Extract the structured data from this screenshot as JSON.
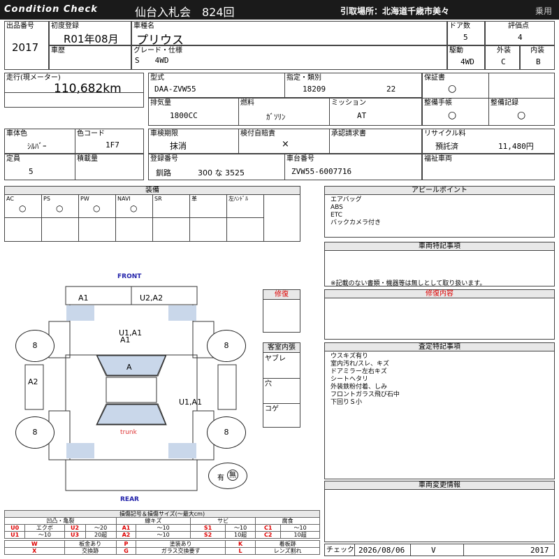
{
  "header": {
    "brand": "Condition Check",
    "auction": "仙台入札会　824回",
    "pickup": "引取場所：北海道千歳市美々",
    "category": "乗用"
  },
  "vehicle": {
    "lot_label": "出品番号",
    "lot": "2017",
    "first_reg_label": "初度登録",
    "first_reg": "R01年08月",
    "model_name_label": "車種名",
    "model_name": "プリウス",
    "doors_label": "ドア数",
    "doors": "5",
    "score_label": "評価点",
    "score": "4",
    "history_label": "車歴",
    "grade_label": "グレード・仕様",
    "grade": "S　　4WD",
    "drive_label": "駆動",
    "drive": "4WD",
    "exterior_label": "外装",
    "exterior": "C",
    "interior_label": "内装",
    "interior": "B",
    "mileage_label": "走行(現メーター)",
    "mileage": "110,682km",
    "type_label": "型式",
    "type": "DAA-ZVW55",
    "designation_label": "指定・類別",
    "designation": "18209",
    "class": "22",
    "warranty_label": "保証書",
    "warranty": "○",
    "displacement_label": "排気量",
    "displacement": "1800CC",
    "fuel_label": "燃料",
    "fuel": "ｶﾞｿﾘﾝ",
    "transmission_label": "ミッション",
    "transmission": "AT",
    "manual_label": "整備手帳",
    "manual": "○",
    "service_label": "整備記録",
    "service": "○",
    "color_label": "車体色",
    "color": "ｼﾙﾊﾞｰ",
    "color_code_label": "色コード",
    "color_code": "1F7",
    "inspection_label": "車検期限",
    "inspection": "抹消",
    "insurance_label": "検付自賠責",
    "insurance": "×",
    "approval_label": "承認請求書",
    "recycle_label": "リサイクル料",
    "recycle_status": "預託済",
    "recycle_fee": "11,480円",
    "capacity_label": "定員",
    "capacity": "5",
    "load_label": "積載量",
    "plate_label": "登録番号",
    "plate_area": "釧路",
    "plate_num": "300 な 3525",
    "chassis_label": "車台番号",
    "chassis": "ZVW55-6007716",
    "welfare_label": "福祉車両"
  },
  "equipment": {
    "title": "装備",
    "items": [
      {
        "label": "AC",
        "mark": "○"
      },
      {
        "label": "PS",
        "mark": "○"
      },
      {
        "label": "PW",
        "mark": "○"
      },
      {
        "label": "NAVI",
        "mark": "○"
      },
      {
        "label": "SR",
        "mark": ""
      },
      {
        "label": "革",
        "mark": ""
      },
      {
        "label": "左ﾊﾝﾄﾞﾙ",
        "mark": ""
      }
    ]
  },
  "appeal": {
    "title": "アピールポイント",
    "lines": [
      "エアバッグ",
      "ABS",
      "ETC",
      "バックカメラ付き"
    ]
  },
  "notes": {
    "title": "車両特記事項",
    "text": "※記載のない書類・機器等は無しとして取り扱います。"
  },
  "repair_content": {
    "title": "修復内容"
  },
  "inspection_notes": {
    "title": "査定特記事項",
    "lines": [
      "ウスキズ有り",
      "室内汚れ/スレ、キズ",
      "ドアミラー左右キズ",
      "シートヘタリ",
      "外装鉄粉付着、しみ",
      "フロントガラス飛び石中",
      "下回りＳ小"
    ]
  },
  "change_info": {
    "title": "車両変更情報"
  },
  "check": {
    "label": "チェック",
    "date": "2026/08/06",
    "mark": "V",
    "number": "2017"
  },
  "diagram": {
    "front": "FRONT",
    "rear": "REAR",
    "marks": {
      "front_left": "A1",
      "front_right": "U2,A2",
      "hood": "U1,A1",
      "hood2": "A1",
      "windshield": "A",
      "left_side": "A2",
      "right_side": "U1,A1",
      "trunk": "trunk",
      "tire_fl": "8",
      "tire_fr": "8",
      "tire_rl": "8",
      "tire_rr": "8",
      "spare_left": "有",
      "spare_right": "無"
    }
  },
  "repair_box": {
    "title": "修復"
  },
  "cabin": {
    "title": "客室内張",
    "items": [
      "ヤブレ",
      "穴",
      "コゲ"
    ]
  },
  "legend": {
    "title": "損傷記号＆損傷サイズ(〜最大cm)",
    "col1": "凹凸・亀裂",
    "col2": "線キズ",
    "col3": "サビ",
    "col4": "腐食",
    "row1": [
      "U0",
      "エクボ",
      "U2",
      "〜20",
      "A1",
      "〜10",
      "S1",
      "〜10",
      "C1",
      "〜10"
    ],
    "row2": [
      "U1",
      "〜10",
      "U3",
      "20超",
      "A2",
      "〜10",
      "S2",
      "10超",
      "C2",
      "10超"
    ],
    "row3": [
      "W",
      "板金あり",
      "P",
      "塗装あり",
      "K",
      "着板跡"
    ],
    "row4": [
      "X",
      "交換跡",
      "G",
      "ガラス交換要す",
      "L",
      "レンズ割れ"
    ]
  },
  "colors": {
    "header_bg": "#1a1a1a",
    "panel_blue": "#c9d7ea",
    "red": "#dd0000"
  }
}
